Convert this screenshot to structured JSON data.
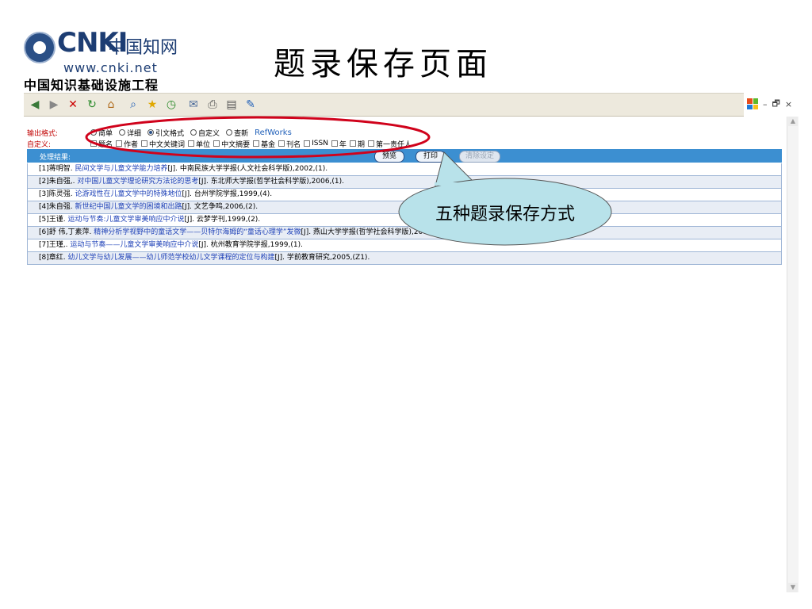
{
  "slide": {
    "title": "题录保存页面",
    "callout": "五种题录保存方式"
  },
  "logo": {
    "letters": "CNKI",
    "cn_name": "中国知网",
    "url": "www.cnki.net",
    "subtitle": "中国知识基础设施工程"
  },
  "toolbar": {
    "items": [
      {
        "name": "back-icon",
        "glyph": "◀"
      },
      {
        "name": "forward-icon",
        "glyph": "▶"
      },
      {
        "name": "stop-icon",
        "glyph": "✕"
      },
      {
        "name": "refresh-icon",
        "glyph": "↻"
      },
      {
        "name": "home-icon",
        "glyph": "⌂"
      },
      {
        "name": "search-icon",
        "glyph": "⌕"
      },
      {
        "name": "favorites-icon",
        "glyph": "★"
      },
      {
        "name": "history-icon",
        "glyph": "◷"
      },
      {
        "name": "mail-icon",
        "glyph": "✉"
      },
      {
        "name": "print-icon",
        "glyph": "⎙"
      },
      {
        "name": "edit-icon",
        "glyph": "▤"
      },
      {
        "name": "messenger-icon",
        "glyph": "✎"
      }
    ]
  },
  "window_controls": {
    "minimize": "–",
    "restore": "🗗",
    "close": "×"
  },
  "form": {
    "output_label": "输出格式:",
    "custom_label": "自定义:",
    "formats": [
      {
        "label": "简单",
        "selected": false
      },
      {
        "label": "详细",
        "selected": false
      },
      {
        "label": "引文格式",
        "selected": true
      },
      {
        "label": "自定义",
        "selected": false
      },
      {
        "label": "查新",
        "selected": false
      }
    ],
    "refworks": "RefWorks",
    "fields": [
      "题名",
      "作者",
      "中文关键词",
      "单位",
      "中文摘要",
      "基金",
      "刊名",
      "ISSN",
      "年",
      "期",
      "第一责任人"
    ]
  },
  "result_header": {
    "label": "处理结果:",
    "preview": "预览",
    "print": "打印",
    "clear": "清除设定"
  },
  "results": [
    {
      "pre": "[1]蒋明智. ",
      "title": "民间文学与儿童文学能力培养",
      "post": "[J]. 中南民族大学学报(人文社会科学版),2002,(1)."
    },
    {
      "pre": "[2]朱自强,. ",
      "title": "对中国儿童文学理论研究方法论的思考",
      "post": "[J]. 东北师大学报(哲学社会科学版),2006,(1)."
    },
    {
      "pre": "[3]陈灵强. ",
      "title": "论游戏性在儿童文学中的特殊地位",
      "post": "[J]. 台州学院学报,1999,(4)."
    },
    {
      "pre": "[4]朱自强. ",
      "title": "新世纪中国儿童文学的困境和出路",
      "post": "[J]. 文艺争鸣,2006,(2)."
    },
    {
      "pre": "[5]王谨. ",
      "title": "运动与节奏:儿童文学审美响应中介说",
      "post": "[J]. 云梦学刊,1999,(2)."
    },
    {
      "pre": "[6]舒 伟,丁素萍. ",
      "title": "精神分析学视野中的童话文学——贝特尔海姆的“童话心理学”发微",
      "post": "[J]. 燕山大学学报(哲学社会科学版),2001,(1)."
    },
    {
      "pre": "[7]王瑾,. ",
      "title": "运动与节奏——儿童文学审美响应中介说",
      "post": "[J]. 杭州教育学院学报,1999,(1)."
    },
    {
      "pre": "[8]章红. ",
      "title": "幼儿文学与幼儿发展——幼儿师范学校幼儿文学课程的定位与构建",
      "post": "[J]. 学前教育研究,2005,(Z1)."
    }
  ],
  "colors": {
    "accent": "#3c8fd1",
    "annotation": "#d0021b",
    "callout_fill": "#b8e2ea"
  }
}
